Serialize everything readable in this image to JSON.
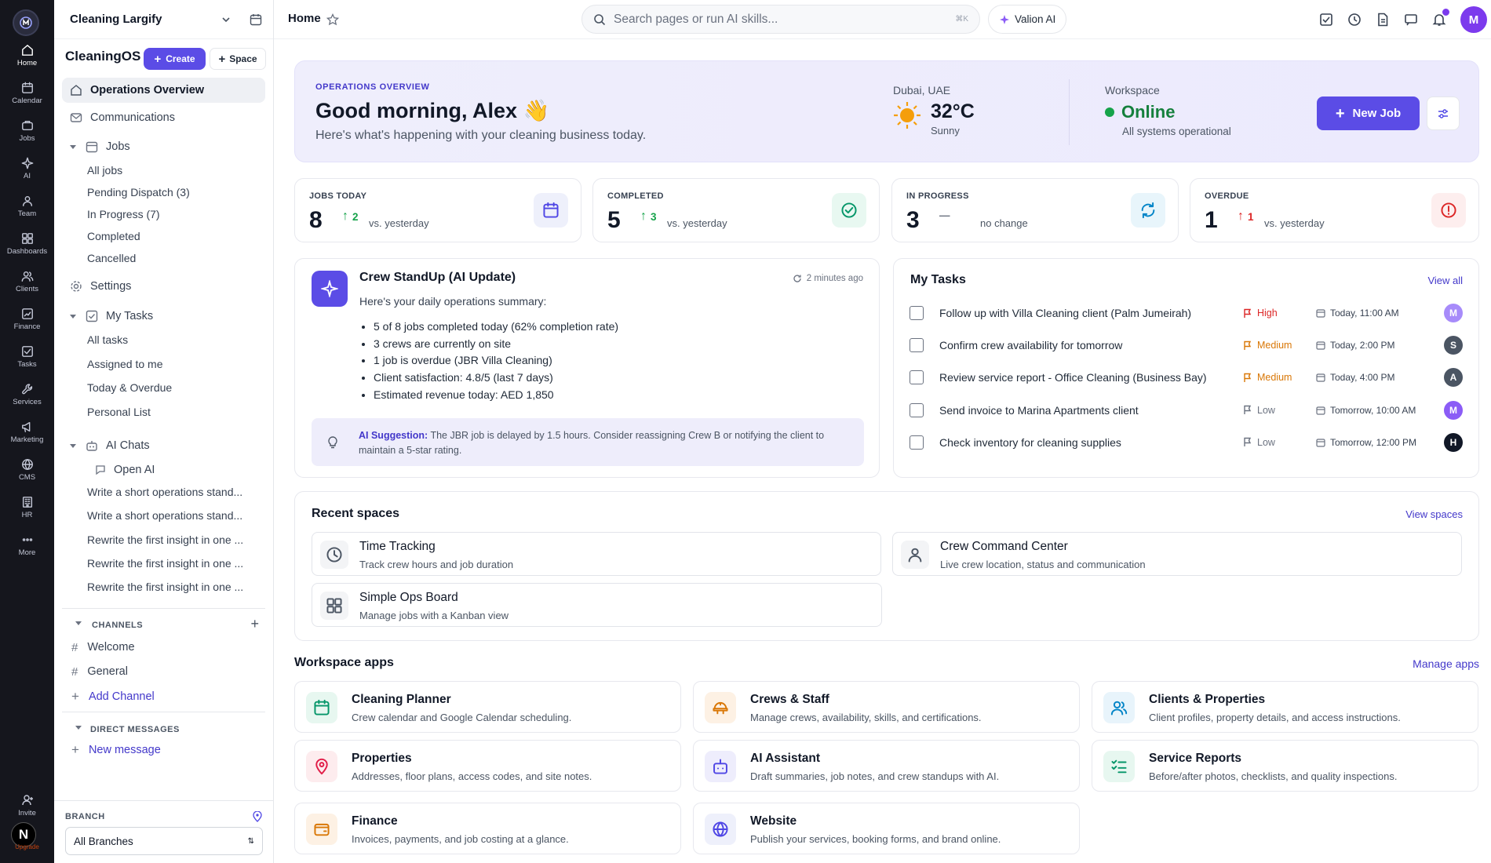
{
  "rail": {
    "items": [
      {
        "label": "Home",
        "icon": "home-icon"
      },
      {
        "label": "Calendar",
        "icon": "calendar-icon"
      },
      {
        "label": "Jobs",
        "icon": "briefcase-icon"
      },
      {
        "label": "AI",
        "icon": "sparkle-icon"
      },
      {
        "label": "Team",
        "icon": "team-icon"
      },
      {
        "label": "Dashboards",
        "icon": "dashboard-icon"
      },
      {
        "label": "Clients",
        "icon": "clients-icon"
      },
      {
        "label": "Finance",
        "icon": "finance-icon"
      },
      {
        "label": "Tasks",
        "icon": "tasks-icon"
      },
      {
        "label": "Services",
        "icon": "services-icon"
      },
      {
        "label": "Marketing",
        "icon": "megaphone-icon"
      },
      {
        "label": "CMS",
        "icon": "globe-icon"
      },
      {
        "label": "HR",
        "icon": "building-icon"
      },
      {
        "label": "More",
        "icon": "more-icon"
      }
    ],
    "invite_label": "Invite",
    "avatar_letter": "N",
    "upgrade_label": "Upgrade"
  },
  "sidebar": {
    "workspace_name": "Cleaning Largify",
    "brand": "CleaningOS",
    "create_label": "Create",
    "space_label": "Space",
    "nav": {
      "operations": "Operations Overview",
      "communications": "Communications",
      "jobs": "Jobs",
      "jobs_sub": [
        "All jobs",
        "Pending Dispatch (3)",
        "In Progress (7)",
        "Completed",
        "Cancelled"
      ],
      "settings": "Settings",
      "my_tasks": "My Tasks",
      "tasks_sub": [
        "All tasks",
        "Assigned to me",
        "Today & Overdue",
        "Personal List"
      ],
      "ai_chats": "AI Chats",
      "open_ai": "Open AI",
      "chats": [
        "Write a short operations stand...",
        "Write a short operations stand...",
        "Rewrite the first insight in one ...",
        "Rewrite the first insight in one ...",
        "Rewrite the first insight in one ..."
      ]
    },
    "channels_label": "CHANNELS",
    "channels": [
      "Welcome",
      "General"
    ],
    "add_channel": "Add Channel",
    "dm_label": "DIRECT MESSAGES",
    "new_message": "New message",
    "branch_label": "BRANCH",
    "branch_value": "All Branches"
  },
  "topbar": {
    "title": "Home",
    "search_placeholder": "Search pages or run AI skills...",
    "search_shortcut": "⌘K",
    "ai_button": "Valion AI",
    "avatar_letter": "M"
  },
  "hero": {
    "eyebrow": "OPERATIONS OVERVIEW",
    "greeting": "Good morning, Alex 👋",
    "subtitle": "Here's what's happening with your cleaning business today.",
    "location": "Dubai, UAE",
    "temperature": "32°C",
    "condition": "Sunny",
    "workspace_label": "Workspace",
    "status": "Online",
    "status_detail": "All systems operational",
    "new_job_label": "New Job"
  },
  "stats": [
    {
      "label": "JOBS TODAY",
      "value": "8",
      "delta": "2",
      "note": "vs. yesterday",
      "color": "#16a34a",
      "tile": "#eef0fb",
      "icon": "calendar-icon",
      "icon_color": "#4f46e5"
    },
    {
      "label": "COMPLETED",
      "value": "5",
      "delta": "3",
      "note": "vs. yesterday",
      "color": "#16a34a",
      "tile": "#e8f8f1",
      "icon": "check-circle-icon",
      "icon_color": "#059669"
    },
    {
      "label": "IN PROGRESS",
      "value": "3",
      "delta": "—",
      "note": "no change",
      "color": "#6b7280",
      "tile": "#e8f5fb",
      "icon": "refresh-icon",
      "icon_color": "#0284c7"
    },
    {
      "label": "OVERDUE",
      "value": "1",
      "delta": "1",
      "note": "vs. yesterday",
      "color": "#dc2626",
      "tile": "#fdeeee",
      "icon": "alert-icon",
      "icon_color": "#dc2626"
    }
  ],
  "standup": {
    "title": "Crew StandUp (AI Update)",
    "time": "2 minutes ago",
    "intro": "Here's your daily operations summary:",
    "bullets": [
      "5 of 8 jobs completed today (62% completion rate)",
      "3 crews are currently on site",
      "1 job is overdue (JBR Villa Cleaning)",
      "Client satisfaction: 4.8/5 (last 7 days)",
      "Estimated revenue today: AED 1,850"
    ],
    "suggestion_label": "AI Suggestion:",
    "suggestion_line1": "The JBR job is delayed by 1.5 hours. Consider reassigning Crew B or notifying the client to",
    "suggestion_line2": "maintain a 5-star rating."
  },
  "tasks": {
    "title": "My Tasks",
    "view_all": "View all",
    "items": [
      {
        "text": "Follow up with Villa Cleaning client (Palm Jumeirah)",
        "priority": "High",
        "pcolor": "#dc2626",
        "due": "Today, 11:00 AM",
        "avatar": "M",
        "acolor": "#a78bfa"
      },
      {
        "text": "Confirm crew availability for tomorrow",
        "priority": "Medium",
        "pcolor": "#d97706",
        "due": "Today, 2:00 PM",
        "avatar": "S",
        "acolor": "#4b5563"
      },
      {
        "text": "Review service report - Office Cleaning (Business Bay)",
        "priority": "Medium",
        "pcolor": "#d97706",
        "due": "Today, 4:00 PM",
        "avatar": "A",
        "acolor": "#4b5563"
      },
      {
        "text": "Send invoice to Marina Apartments client",
        "priority": "Low",
        "pcolor": "#6b7280",
        "due": "Tomorrow, 10:00 AM",
        "avatar": "M",
        "acolor": "#8b5cf6"
      },
      {
        "text": "Check inventory for cleaning supplies",
        "priority": "Low",
        "pcolor": "#6b7280",
        "due": "Tomorrow, 12:00 PM",
        "avatar": "H",
        "acolor": "#111827"
      }
    ]
  },
  "spaces": {
    "title": "Recent spaces",
    "view": "View spaces",
    "items": [
      {
        "title": "Time Tracking",
        "desc": "Track crew hours and job duration",
        "icon": "clock-icon"
      },
      {
        "title": "Crew Command Center",
        "desc": "Live crew location, status and communication",
        "icon": "team-icon"
      },
      {
        "title": "Simple Ops Board",
        "desc": "Manage jobs with a Kanban view",
        "icon": "grid-icon"
      }
    ]
  },
  "apps": {
    "title": "Workspace apps",
    "manage": "Manage apps",
    "items": [
      {
        "title": "Cleaning Planner",
        "desc": "Crew calendar and Google Calendar scheduling.",
        "tile": "#e7f7f0",
        "color": "#059669",
        "icon": "calendar-icon"
      },
      {
        "title": "Crews & Staff",
        "desc": "Manage crews, availability, skills, and certifications.",
        "tile": "#fdf1e4",
        "color": "#d97706",
        "icon": "crew-icon"
      },
      {
        "title": "Clients & Properties",
        "desc": "Client profiles, property details, and access instructions.",
        "tile": "#e8f4fb",
        "color": "#0284c7",
        "icon": "clients-icon"
      },
      {
        "title": "Properties",
        "desc": "Addresses, floor plans, access codes, and site notes.",
        "tile": "#fdecee",
        "color": "#e11d48",
        "icon": "pin-icon"
      },
      {
        "title": "AI Assistant",
        "desc": "Draft summaries, job notes, and crew standups with AI.",
        "tile": "#eeedfc",
        "color": "#4f46e5",
        "icon": "robot-icon"
      },
      {
        "title": "Service Reports",
        "desc": "Before/after photos, checklists, and quality inspections.",
        "tile": "#e7f7f0",
        "color": "#059669",
        "icon": "checklist-icon"
      },
      {
        "title": "Finance",
        "desc": "Invoices, payments, and job costing at a glance.",
        "tile": "#fdf1e4",
        "color": "#d97706",
        "icon": "wallet-icon"
      },
      {
        "title": "Website",
        "desc": "Publish your services, booking forms, and brand online.",
        "tile": "#eef0fb",
        "color": "#4f46e5",
        "icon": "globe-icon"
      }
    ]
  }
}
